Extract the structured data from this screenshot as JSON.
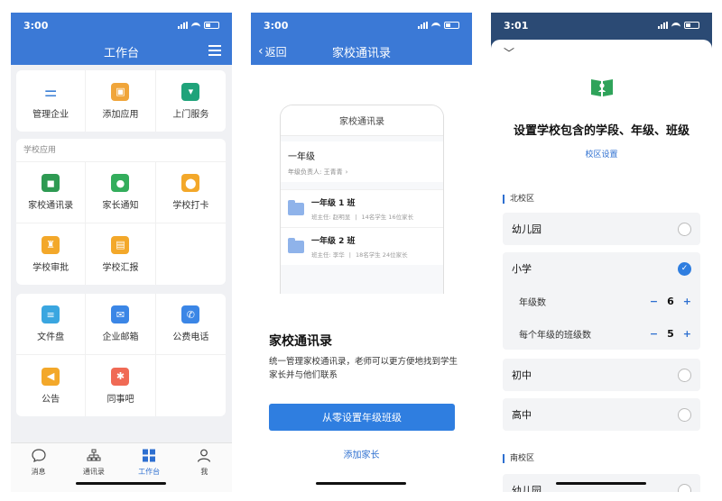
{
  "workbench": {
    "status_time": "3:00",
    "title": "工作台",
    "top_apps": [
      {
        "label": "管理企业",
        "icon": "sliders-icon",
        "color": "#3b7fd6"
      },
      {
        "label": "添加应用",
        "icon": "add-app-icon",
        "color": "#f0a53a"
      },
      {
        "label": "上门服务",
        "icon": "tie-icon",
        "color": "#1fa37a"
      }
    ],
    "school_section_title": "学校应用",
    "school_apps": [
      {
        "label": "家校通讯录",
        "icon": "contact-card-icon",
        "color": "#2e9a52"
      },
      {
        "label": "家长通知",
        "icon": "chat-bubble-icon",
        "color": "#33ad5c"
      },
      {
        "label": "学校打卡",
        "icon": "location-pin-icon",
        "color": "#f3a82a"
      },
      {
        "label": "学校审批",
        "icon": "stamp-icon",
        "color": "#f3a82a"
      },
      {
        "label": "学校汇报",
        "icon": "report-icon",
        "color": "#f3a82a"
      }
    ],
    "more_apps": [
      {
        "label": "文件盘",
        "icon": "database-icon",
        "color": "#3aa6e0"
      },
      {
        "label": "企业邮箱",
        "icon": "mail-icon",
        "color": "#3b86e6"
      },
      {
        "label": "公费电话",
        "icon": "phone-icon",
        "color": "#3b86e6"
      },
      {
        "label": "公告",
        "icon": "megaphone-icon",
        "color": "#f3a82a"
      },
      {
        "label": "同事吧",
        "icon": "share-hub-icon",
        "color": "#f06a55"
      }
    ],
    "tabs": [
      {
        "label": "消息",
        "icon": "message-icon"
      },
      {
        "label": "通讯录",
        "icon": "org-chart-icon"
      },
      {
        "label": "工作台",
        "icon": "grid-icon"
      },
      {
        "label": "我",
        "icon": "person-icon"
      }
    ],
    "active_tab": "工作台"
  },
  "contacts_intro": {
    "status_time": "3:00",
    "back_label": "返回",
    "title": "家校通讯录",
    "mock": {
      "title": "家校通讯录",
      "grade_name": "一年级",
      "grade_owner": "年级负责人: 王青青",
      "classes": [
        {
          "name": "一年级 1 班",
          "teacher": "班主任: 赵明显",
          "stats": "14名学生 16位家长"
        },
        {
          "name": "一年级 2 班",
          "teacher": "班主任: 李华",
          "stats": "18名学生 24位家长"
        }
      ]
    },
    "heading": "家校通讯录",
    "description": "统一管理家校通讯录，老师可以更方便地找到学生家长并与他们联系",
    "primary_button": "从零设置年级班级",
    "secondary_link": "添加家长"
  },
  "school_setup": {
    "status_time": "3:01",
    "title": "设置学校包含的学段、年级、班级",
    "subtitle_link": "校区设置",
    "campus_north": "北校区",
    "campus_south": "南校区",
    "stages": [
      {
        "label": "幼儿园",
        "selected": false
      },
      {
        "label": "小学",
        "selected": true
      },
      {
        "label": "初中",
        "selected": false
      },
      {
        "label": "高中",
        "selected": false
      }
    ],
    "primary_settings": [
      {
        "label": "年级数",
        "value": "6"
      },
      {
        "label": "每个年级的班级数",
        "value": "5"
      }
    ],
    "south_first_stage": "幼儿园",
    "accent_color": "#2f7ee0"
  }
}
